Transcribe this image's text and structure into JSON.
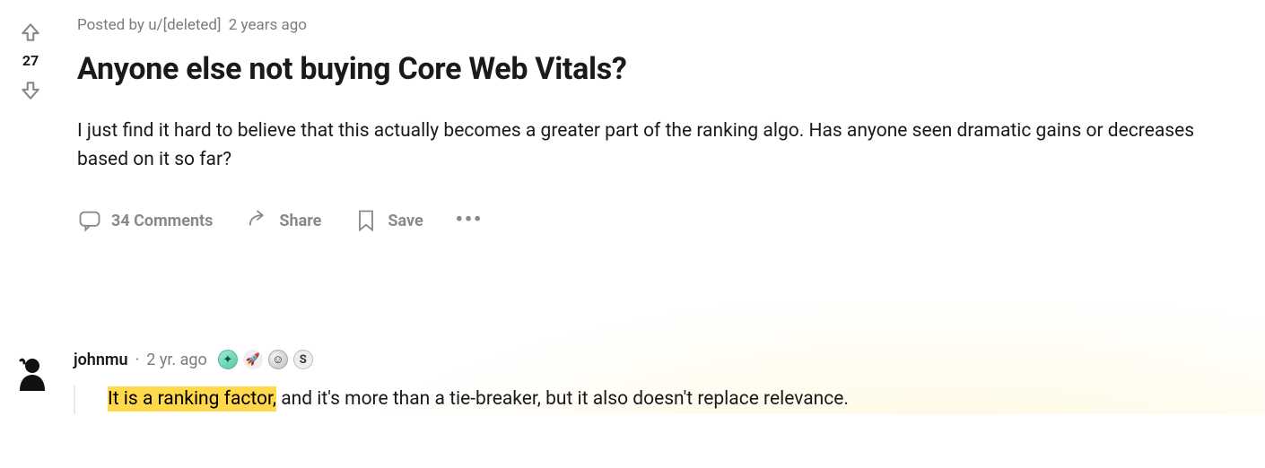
{
  "post": {
    "score": "27",
    "meta_prefix": "Posted by ",
    "author_prefix": "u/",
    "author": "[deleted]",
    "age": "2 years ago",
    "title": "Anyone else not buying Core Web Vitals?",
    "body": "I just find it hard to believe that this actually becomes a greater part of the ranking algo. Has anyone seen dramatic gains or decreases based on it so far?",
    "actions": {
      "comments": "34 Comments",
      "share": "Share",
      "save": "Save"
    }
  },
  "comment": {
    "author": "johnmu",
    "sep": "·",
    "age": "2 yr. ago",
    "highlight": "It is a ranking factor,",
    "rest": " and it's more than a tie-breaker, but it also doesn't replace relevance.",
    "badges": [
      "compass",
      "rocket",
      "face",
      "s"
    ]
  }
}
